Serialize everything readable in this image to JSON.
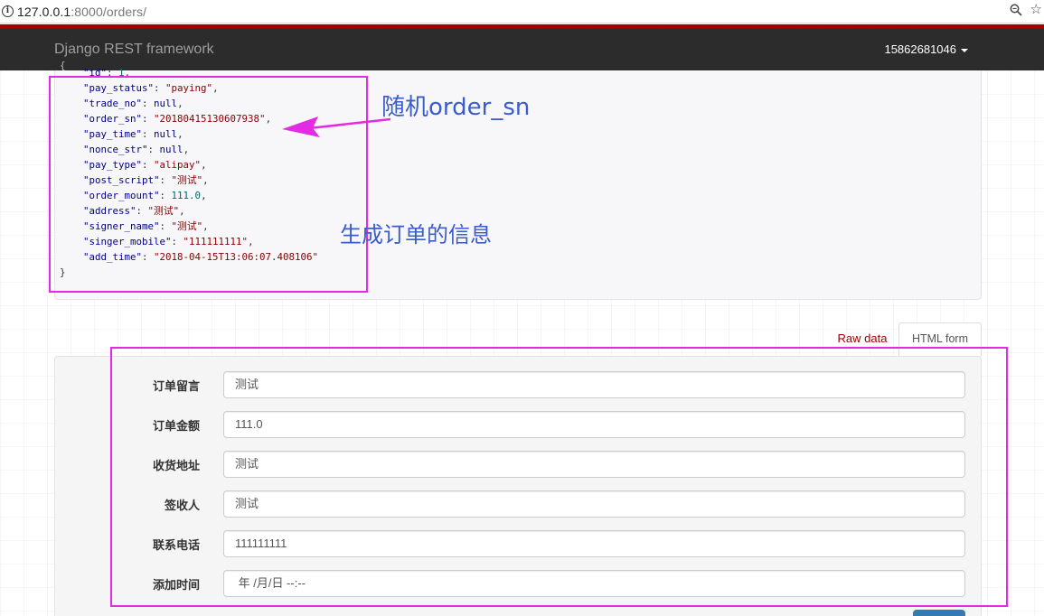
{
  "browser": {
    "url_host": "127.0.0.1",
    "url_rest": ":8000/orders/",
    "info_glyph": "i",
    "star_glyph": "☆"
  },
  "navbar": {
    "brand": "Django REST framework",
    "user": "15862681046"
  },
  "response": {
    "open_brace": "{",
    "close_brace": "}",
    "fields": [
      {
        "key": "\"id\"",
        "value": "1",
        "type": "num"
      },
      {
        "key": "\"pay_status\"",
        "value": "\"paying\"",
        "type": "str"
      },
      {
        "key": "\"trade_no\"",
        "value": "null",
        "type": "kw"
      },
      {
        "key": "\"order_sn\"",
        "value": "\"20180415130607938\"",
        "type": "str"
      },
      {
        "key": "\"pay_time\"",
        "value": "null",
        "type": "kw"
      },
      {
        "key": "\"nonce_str\"",
        "value": "null",
        "type": "kw"
      },
      {
        "key": "\"pay_type\"",
        "value": "\"alipay\"",
        "type": "str"
      },
      {
        "key": "\"post_script\"",
        "value": "\"测试\"",
        "type": "str"
      },
      {
        "key": "\"order_mount\"",
        "value": "111.0",
        "type": "num"
      },
      {
        "key": "\"address\"",
        "value": "\"测试\"",
        "type": "str"
      },
      {
        "key": "\"signer_name\"",
        "value": "\"测试\"",
        "type": "str"
      },
      {
        "key": "\"singer_mobile\"",
        "value": "\"111111111\"",
        "type": "str"
      },
      {
        "key": "\"add_time\"",
        "value": "\"2018-04-15T13:06:07.408106\"",
        "type": "str"
      }
    ]
  },
  "annotations": {
    "order_sn_note": "随机order_sn",
    "info_note": "生成订单的信息",
    "color": "#e22be2",
    "text_color": "#3b5dc9"
  },
  "tabs": {
    "raw": "Raw data",
    "html": "HTML form"
  },
  "form": {
    "fields": [
      {
        "label": "订单留言",
        "value": "测试"
      },
      {
        "label": "订单金额",
        "value": "111.0"
      },
      {
        "label": "收货地址",
        "value": "测试"
      },
      {
        "label": "签收人",
        "value": "测试"
      },
      {
        "label": "联系电话",
        "value": "111111111"
      },
      {
        "label": "添加时间",
        "value": " 年 /月/日 --:--"
      }
    ]
  },
  "colors": {
    "navbar": "#2c2c2c",
    "stripe": "#a30000",
    "primary_button": "#337ab7"
  }
}
